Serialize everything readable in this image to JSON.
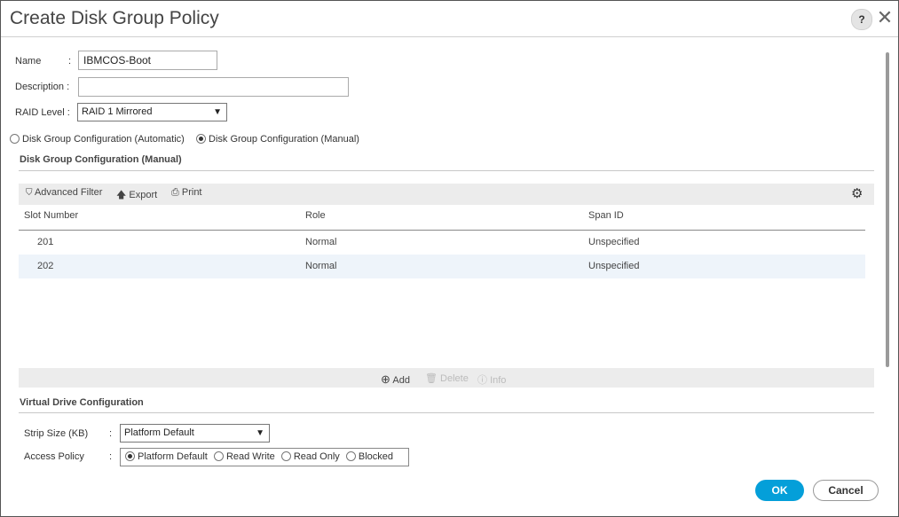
{
  "dialog": {
    "title": "Create Disk Group Policy",
    "help_label": "?",
    "close_label": "✕"
  },
  "form": {
    "name_label": "Name",
    "name_colon": ":",
    "name_value": "IBMCOS-Boot",
    "description_label": "Description :",
    "description_value": "",
    "raid_label": "RAID Level :",
    "raid_value": "RAID 1 Mirrored",
    "config_auto_label": "Disk Group Configuration (Automatic)",
    "config_manual_label": "Disk Group Configuration (Manual)",
    "config_selected": "manual"
  },
  "disk_group": {
    "section_title": "Disk Group Configuration (Manual)",
    "toolbar": {
      "advanced_filter": "Advanced Filter",
      "export": "Export",
      "print": "Print"
    },
    "columns": [
      "Slot Number",
      "Role",
      "Span ID"
    ],
    "rows": [
      {
        "slot": "201",
        "role": "Normal",
        "span": "Unspecified"
      },
      {
        "slot": "202",
        "role": "Normal",
        "span": "Unspecified"
      }
    ],
    "actions": {
      "add": "Add",
      "delete": "Delete",
      "info": "Info"
    }
  },
  "virtual_drive": {
    "section_title": "Virtual Drive Configuration",
    "strip_label": "Strip Size (KB)",
    "strip_colon": ":",
    "strip_value": "Platform Default",
    "access_label": "Access Policy",
    "access_colon": ":",
    "access_options": [
      "Platform Default",
      "Read Write",
      "Read Only",
      "Blocked"
    ],
    "access_selected": "Platform Default"
  },
  "buttons": {
    "ok": "OK",
    "cancel": "Cancel"
  },
  "colors": {
    "primary": "#049fd9",
    "row_alt": "#eef4fa",
    "toolbar_bg": "#ececec"
  }
}
